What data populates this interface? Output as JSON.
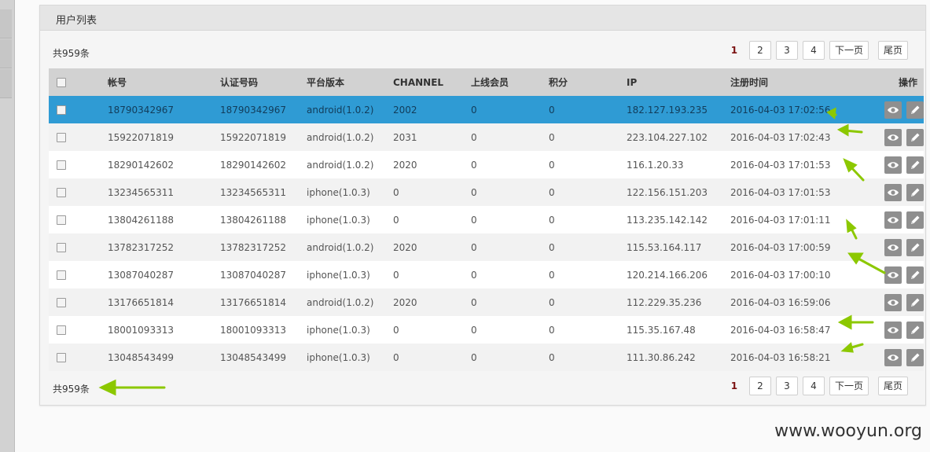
{
  "panel": {
    "title": "用户列表"
  },
  "total_text": "共959条",
  "pager": {
    "pages": [
      "1",
      "2",
      "3",
      "4"
    ],
    "current": "1",
    "next": "下一页",
    "last": "尾页"
  },
  "table": {
    "headers": [
      "帐号",
      "认证号码",
      "平台版本",
      "CHANNEL",
      "上线会员",
      "积分",
      "IP",
      "注册时间",
      "操作"
    ],
    "rows": [
      [
        "18790342967",
        "18790342967",
        "android(1.0.2)",
        "2002",
        "0",
        "0",
        "182.127.193.235",
        "2016-04-03 17:02:56"
      ],
      [
        "15922071819",
        "15922071819",
        "android(1.0.2)",
        "2031",
        "0",
        "0",
        "223.104.227.102",
        "2016-04-03 17:02:43"
      ],
      [
        "18290142602",
        "18290142602",
        "android(1.0.2)",
        "2020",
        "0",
        "0",
        "116.1.20.33",
        "2016-04-03 17:01:53"
      ],
      [
        "13234565311",
        "13234565311",
        "iphone(1.0.3)",
        "0",
        "0",
        "0",
        "122.156.151.203",
        "2016-04-03 17:01:53"
      ],
      [
        "13804261188",
        "13804261188",
        "iphone(1.0.3)",
        "0",
        "0",
        "0",
        "113.235.142.142",
        "2016-04-03 17:01:11"
      ],
      [
        "13782317252",
        "13782317252",
        "android(1.0.2)",
        "2020",
        "0",
        "0",
        "115.53.164.117",
        "2016-04-03 17:00:59"
      ],
      [
        "13087040287",
        "13087040287",
        "iphone(1.0.3)",
        "0",
        "0",
        "0",
        "120.214.166.206",
        "2016-04-03 17:00:10"
      ],
      [
        "13176651814",
        "13176651814",
        "android(1.0.2)",
        "2020",
        "0",
        "0",
        "112.229.35.236",
        "2016-04-03 16:59:06"
      ],
      [
        "18001093313",
        "18001093313",
        "iphone(1.0.3)",
        "0",
        "0",
        "0",
        "115.35.167.48",
        "2016-04-03 16:58:47"
      ],
      [
        "13048543499",
        "13048543499",
        "iphone(1.0.3)",
        "0",
        "0",
        "0",
        "111.30.86.242",
        "2016-04-03 16:58:21"
      ]
    ],
    "selected_row": 0,
    "action_icons": [
      "eye-icon",
      "pencil-icon"
    ]
  },
  "watermark": "www.wooyun.org",
  "colors": {
    "selected_row": "#2f9bd4",
    "header_bg": "#d2d2d2",
    "annotation_arrow": "#8cc800",
    "current_page": "#7a1010"
  }
}
